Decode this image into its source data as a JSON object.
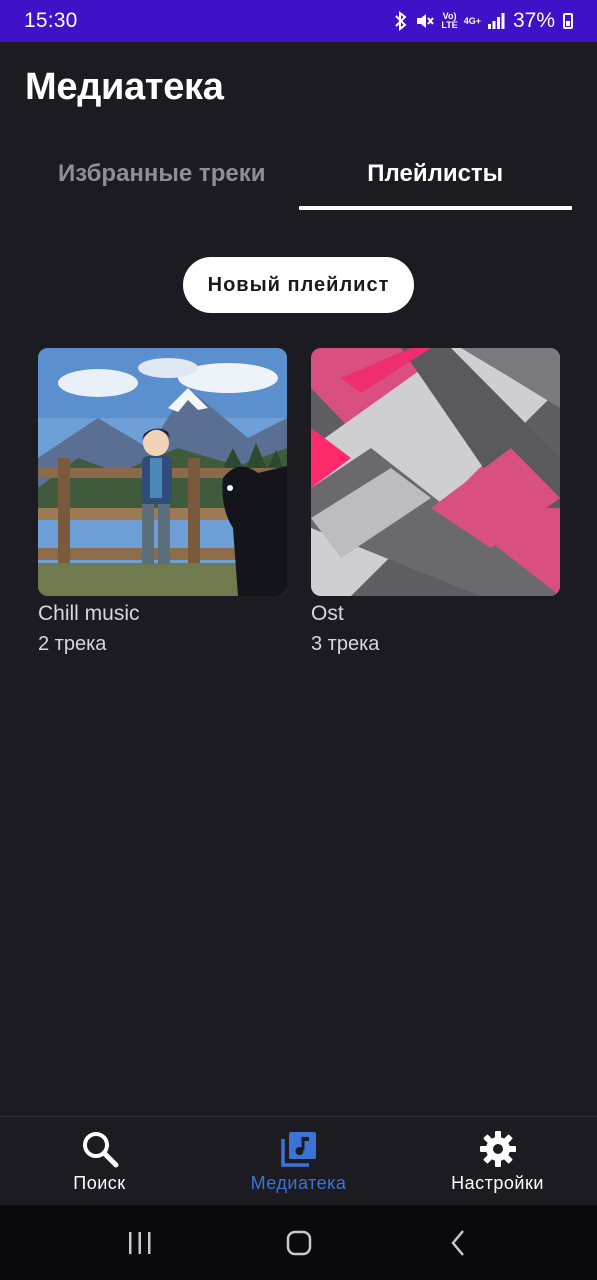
{
  "status_bar": {
    "time": "15:30",
    "network_volte": "Vo)\nLTE",
    "network_4g": "4G+",
    "battery_percent": "37%",
    "icons": [
      "bluetooth-icon",
      "mute-icon",
      "volte-icon",
      "4g-icon",
      "signal-icon",
      "battery-icon"
    ]
  },
  "header": {
    "title": "Медиатека"
  },
  "tabs": [
    {
      "label": "Избранные треки",
      "active": false
    },
    {
      "label": "Плейлисты",
      "active": true
    }
  ],
  "new_playlist_button": {
    "label": "Новый плейлист"
  },
  "playlists": [
    {
      "name": "Chill music",
      "track_count": "2 трека",
      "cover": "anime-boy-horse-mountains"
    },
    {
      "name": "Ost",
      "track_count": "3 трека",
      "cover": "pink-grey-abstract-stripes"
    }
  ],
  "bottom_nav": {
    "items": [
      {
        "label": "Поиск",
        "icon": "search-icon",
        "active": false
      },
      {
        "label": "Медиатека",
        "icon": "music-library-icon",
        "active": true
      },
      {
        "label": "Настройки",
        "icon": "settings-gear-icon",
        "active": false
      }
    ],
    "active_color": "#3b74d6"
  },
  "colors": {
    "status_bar": "#3f12c8",
    "background": "#1c1b22",
    "accent": "#3b74d6"
  }
}
